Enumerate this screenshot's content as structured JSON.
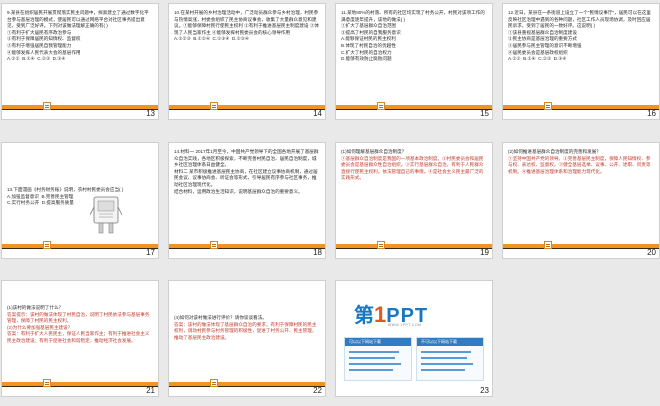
{
  "slides": [
    {
      "number": "13",
      "text": "9.某县在组织居民开展贯彻落实民主问题中，探索建立了通过数字化平台参与基层治理的模式，使居民可以通过网络平台对社区事务提出意见，受到广泛好评。下列对该做法理解正确的有( )\n①有利于扩大居民有序政治参与\n②有利于保障居民的知情权、监督权\n③有利于增强居民自我管理能力\n④能够发挥人民代表大会的基层作用\nA.①②  B.①④  C.②③  D.③④"
    },
    {
      "number": "14",
      "text": "10.在某村开展的乡村治理活动中，广泛动员群众参与乡村治理，村民参与热情高涨，村委会组织了民主协商议事会，收集了大量群众意见和建议。①能够保障村民行使民主权利 ②有利于推进基层民主制度建设 ③体现了人民当家作主 ④能够发挥村民委员会的核心领导作用\nA.①②③  B.①②④  C.①③④  D.②③④"
    },
    {
      "number": "15",
      "text": "11.某地80%的村落、所有的社区均实现了村务公开，村民对该项工作的满意度逐年提升，该地的做法( )\n①扩大了基层群众自治范围\n②提高了村民的自我服务意识\nA.能够保证村民的民主权利\nB.体现了村民自治的优越性\nC.扩大了村民的自治权力\nD.能够有效防止腐败问题"
    },
    {
      "number": "16",
      "text": "12.近日，某县在一条街道上设立了一个\"民情议事厅\"，居民可以在这里反映社区治理中遇到的各种问题，社区工作人员现场协调，及时回应居民诉求，受到了居民的一致好评。这说明( )\n①该县重视基层群众自治制度建设\n②民主协商是基层治理的重要方式\n③居民参与民主管理的意识不断增强\n④居民委员会是基层政权组织\nA.①②  B.①④  C.②③  D.③④"
    },
    {
      "number": "17",
      "text": "13.下面漫画《村务财务账》说明，农村村民委员会应当( )\nA.加强监督意识  B.完善民主管理\nC.实行村务公开  D.提高服务质量"
    },
    {
      "number": "18",
      "text": "14.材料一 2017年1月至今，中国共产党领导下的全国各地开展了基层群众自治实践，各地区积极探索，不断完善村民自治、居民自治制度，城乡社区治理体系日益健全。\n材料二 某市积极推进基层民主协商，在社区建立议事协商机制，通过居民会议、议事协商会、听证会等形式，引导居民有序参与社区事务，推动社区治理现代化。\n结合材料，运用政治生活知识，说明基层群众自治的重要意义。"
    },
    {
      "number": "19",
      "text": "(1)如何理解基层群众自治制度？",
      "answer": "①基层群众自治制度是我国的一项基本政治制度。②村民委员会和居民委员会是基层群众性自治组织。③实行基层群众自治，有利于人民群众直接行使民主权利，依法管理自己的事情。④是社会主义民主最广泛的实践形式。"
    },
    {
      "number": "20",
      "text": "(2)如何推进基层群众自治制度的完善和发展？",
      "answer": "①坚持中国共产党的领导。②完善基层民主制度，保障人民知情权、参与权、表达权、监督权。③健全基层选举、议事、公开、述职、问责等机制。④推进基层治理体系和治理能力现代化。"
    },
    {
      "number": "21",
      "text": "(1)该村的做法说明了什么？",
      "answer": "答案提示：该村的做法体现了村民自治，说明了村民依法参与基层事务管理，保障了村民的民主权利。\n(2)为什么要加强基层民主建设？",
      "answer2": "答案：有利于扩大人民民主，保证人民当家作主；有利于推进社会主义民主政治建设；有利于促进社会和谐稳定，推动经济社会发展。"
    },
    {
      "number": "22",
      "text": "(4)如何对该村做法进行评价？请你谈谈看法。",
      "answer": "答案：该村的做法体现了基层群众自治的要求，有利于保障村民的民主权利，调动村民参与村务管理的积极性，促进了村务公开、民主管理，推动了基层民主政治建设。"
    },
    {
      "number": "23",
      "logo_di": "第",
      "logo_one": "1",
      "logo_ppt": "PPT",
      "logo_sub": "WWW.1PPT.COM",
      "panel_left": "可以以下网站下载",
      "panel_right": "不可以以下网站下载"
    }
  ]
}
